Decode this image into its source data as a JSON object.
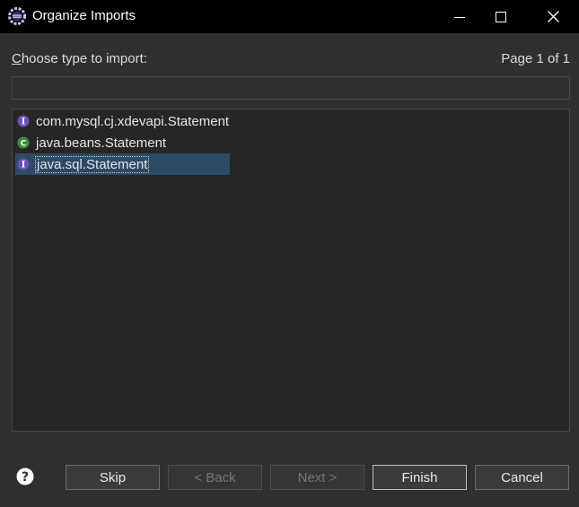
{
  "window": {
    "title": "Organize Imports",
    "icon": "eclipse-gear-icon"
  },
  "dialog": {
    "prompt_label": "Choose type to import:",
    "page_info": "Page 1 of 1",
    "filter_value": "",
    "items": [
      {
        "label": "com.mysql.cj.xdevapi.Statement",
        "kind": "interface",
        "icon": "interface-icon",
        "selected": false
      },
      {
        "label": "java.beans.Statement",
        "kind": "class",
        "icon": "class-icon",
        "selected": false
      },
      {
        "label": "java.sql.Statement",
        "kind": "interface",
        "icon": "interface-icon",
        "selected": true
      }
    ]
  },
  "buttons": {
    "skip": "Skip",
    "back": "< Back",
    "next": "Next >",
    "finish": "Finish",
    "cancel": "Cancel"
  },
  "colors": {
    "background": "#2f2f2f",
    "titlebar": "#000000",
    "list_background": "#262626",
    "selection": "#2d4a66",
    "interface_icon": "#6b4fb8",
    "class_icon": "#3b8f3b"
  }
}
